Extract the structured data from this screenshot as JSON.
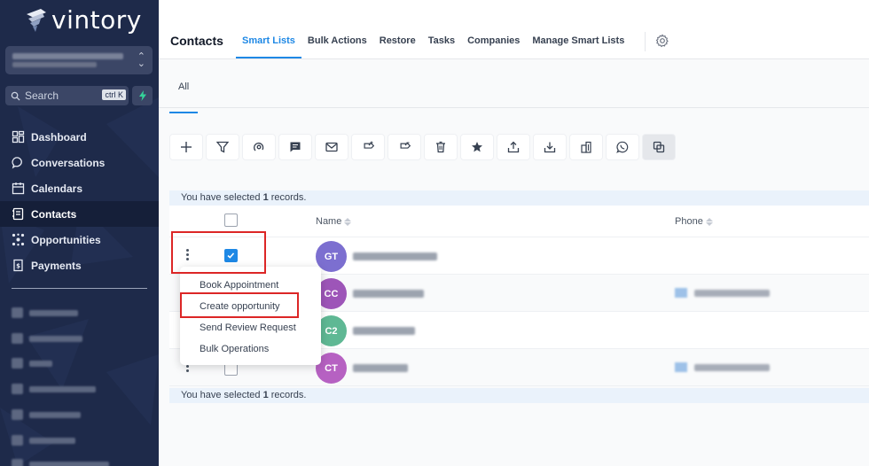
{
  "sidebar": {
    "brand": "vintory",
    "search_placeholder": "Search",
    "search_shortcut": "ctrl K",
    "nav": [
      {
        "label": "Dashboard",
        "icon": "grid-icon"
      },
      {
        "label": "Conversations",
        "icon": "chat-bubble-icon"
      },
      {
        "label": "Calendars",
        "icon": "calendar-icon"
      },
      {
        "label": "Contacts",
        "icon": "contacts-icon",
        "active": true
      },
      {
        "label": "Opportunities",
        "icon": "opportunities-icon"
      },
      {
        "label": "Payments",
        "icon": "payments-icon"
      }
    ]
  },
  "header": {
    "title": "Contacts",
    "tabs": [
      "Smart Lists",
      "Bulk Actions",
      "Restore",
      "Tasks",
      "Companies",
      "Manage Smart Lists"
    ],
    "active_tab": "Smart Lists"
  },
  "subtabs": {
    "all": "All"
  },
  "toolbar": {
    "icons": [
      "plus-icon",
      "filter-icon",
      "automation-icon",
      "message-icon",
      "email-icon",
      "add-tag-icon",
      "remove-tag-icon",
      "delete-icon",
      "star-icon",
      "export-icon",
      "import-icon",
      "company-icon",
      "whatsapp-icon",
      "merge-icon"
    ]
  },
  "selection": {
    "prefix": "You have selected",
    "count": "1",
    "suffix": "records."
  },
  "table": {
    "columns": {
      "name": "Name",
      "phone": "Phone"
    },
    "rows": [
      {
        "initials": "GT",
        "color": "#7c6fd0",
        "checked": true
      },
      {
        "initials": "CC",
        "color": "#9d55b8",
        "checked": false
      },
      {
        "initials": "C2",
        "color": "#5fb894",
        "checked": false
      },
      {
        "initials": "CT",
        "color": "#b661c2",
        "checked": false
      }
    ]
  },
  "context_menu": {
    "items": [
      "Book Appointment",
      "Create opportunity",
      "Send Review Request",
      "Bulk Operations"
    ]
  },
  "colors": {
    "accent": "#1e88e5",
    "sidebar": "#1e2a4a",
    "highlight": "#dc2626"
  }
}
